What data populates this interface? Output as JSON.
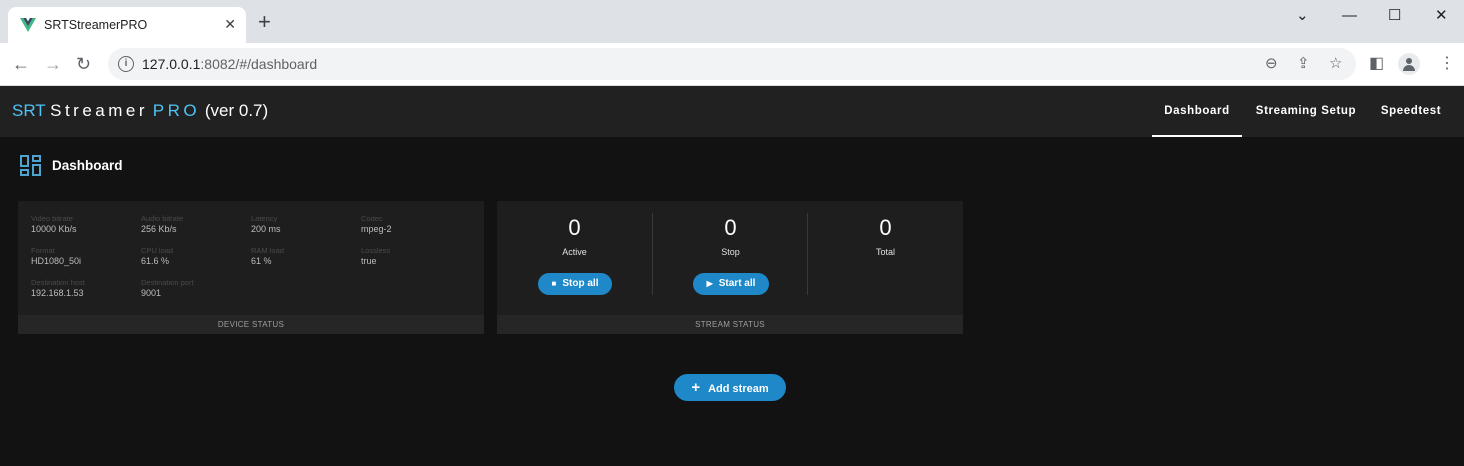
{
  "browser": {
    "tab_title": "SRTStreamerPRO",
    "tab_close": "✕",
    "new_tab": "+",
    "url_host": "127.0.0.1",
    "url_rest": ":8082/#/dashboard",
    "win_min": "⌄",
    "win_restore": "—",
    "win_max": "☐",
    "win_close": "✕"
  },
  "app": {
    "brand_srt": "SRT",
    "brand_streamer": "Streamer",
    "brand_pro": "PRO",
    "brand_version": "(ver 0.7)",
    "nav": [
      {
        "label": "Dashboard",
        "active": true
      },
      {
        "label": "Streaming Setup",
        "active": false
      },
      {
        "label": "Speedtest",
        "active": false
      }
    ]
  },
  "page": {
    "title": "Dashboard"
  },
  "device_status": {
    "footer": "DEVICE STATUS",
    "stats": [
      {
        "label": "Video bitrate",
        "value": "10000 Kb/s"
      },
      {
        "label": "Audio bitrate",
        "value": "256 Kb/s"
      },
      {
        "label": "Latency",
        "value": "200 ms"
      },
      {
        "label": "Codec",
        "value": "mpeg-2"
      },
      {
        "label": "Format",
        "value": "HD1080_50i"
      },
      {
        "label": "CPU load",
        "value": "61.6 %"
      },
      {
        "label": "RAM load",
        "value": "61 %"
      },
      {
        "label": "Lossless",
        "value": "true"
      },
      {
        "label": "Destination host",
        "value": "192.168.1.53"
      },
      {
        "label": "Destination port",
        "value": "9001"
      }
    ]
  },
  "stream_status": {
    "footer": "STREAM STATUS",
    "counters": [
      {
        "value": "0",
        "label": "Active"
      },
      {
        "value": "0",
        "label": "Stop"
      },
      {
        "value": "0",
        "label": "Total"
      }
    ],
    "stop_all_label": "Stop all",
    "start_all_label": "Start all"
  },
  "add_stream_label": "Add stream",
  "colors": {
    "accent": "#4fc3f7",
    "button": "#1e88c8",
    "background": "#121212",
    "card": "#1e1e1e",
    "appbar": "#212121"
  }
}
